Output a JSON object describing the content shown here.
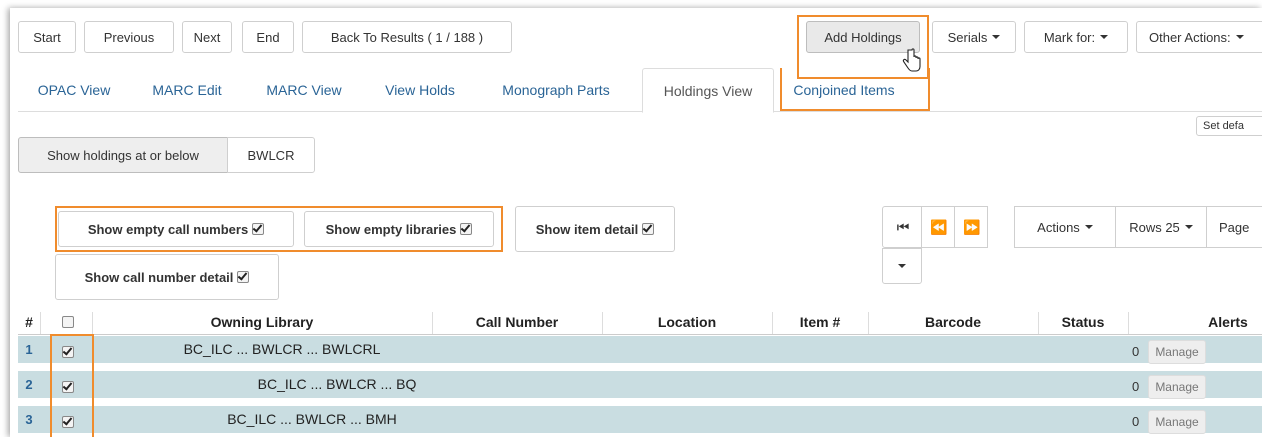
{
  "toolbar": {
    "start": "Start",
    "previous": "Previous",
    "next": "Next",
    "end": "End",
    "back_to_results": "Back To Results ( 1 / 188 )",
    "add_holdings": "Add Holdings",
    "serials": "Serials",
    "mark_for": "Mark for:",
    "other_actions": "Other Actions:"
  },
  "tabs": [
    {
      "label": "OPAC View"
    },
    {
      "label": "MARC Edit"
    },
    {
      "label": "MARC View"
    },
    {
      "label": "View Holds"
    },
    {
      "label": "Monograph Parts"
    },
    {
      "label": "Holdings View"
    },
    {
      "label": "Conjoined Items"
    }
  ],
  "set_default": "Set defa",
  "org_filter": {
    "label": "Show holdings at or below",
    "value": "BWLCR"
  },
  "toggles": {
    "empty_call_numbers": "Show empty call numbers",
    "empty_libraries": "Show empty libraries",
    "item_detail": "Show item detail",
    "call_number_detail": "Show call number detail"
  },
  "grid_toolbar": {
    "actions": "Actions",
    "rows": "Rows 25",
    "page": "Page"
  },
  "table": {
    "columns": [
      "#",
      "Owning Library",
      "Call Number",
      "Location",
      "Item #",
      "Barcode",
      "Status",
      "Alerts"
    ],
    "rows": [
      {
        "num": "1",
        "library": "BC_ILC ... BWLCR ... BWLCRL",
        "alerts": "0",
        "manage": "Manage"
      },
      {
        "num": "2",
        "library": "BC_ILC ... BWLCR ... BQ",
        "alerts": "0",
        "manage": "Manage"
      },
      {
        "num": "3",
        "library": "BC_ILC ... BWLCR ... BMH",
        "alerts": "0",
        "manage": "Manage"
      }
    ]
  },
  "colors": {
    "accent_highlight": "#f08c2d",
    "row_bg": "#c9dde1",
    "link": "#2a6496"
  }
}
